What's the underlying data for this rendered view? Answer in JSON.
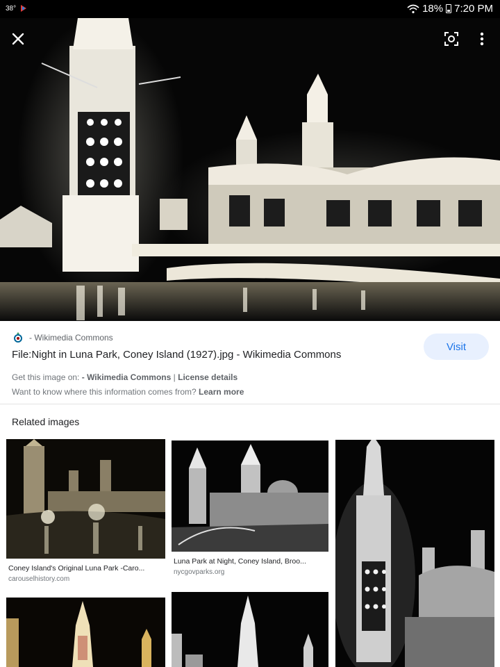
{
  "status": {
    "left_text": "38°",
    "battery": "18%",
    "time": "7:20 PM"
  },
  "image": {
    "source_prefix": "- Wikimedia Commons",
    "title": "File:Night in Luna Park, Coney Island (1927).jpg - Wikimedia Commons",
    "visit_label": "Visit",
    "get_image_label": "Get this image on:",
    "get_image_source": "- Wikimedia Commons",
    "separator": "|",
    "license_label": "License details",
    "info_question": "Want to know where this information comes from?",
    "learn_more": "Learn more"
  },
  "related": {
    "heading": "Related images",
    "items": [
      {
        "caption": "Coney Island's Original Luna Park -Caro...",
        "domain": "carouselhistory.com"
      },
      {
        "caption": "Luna Park at Night, Coney Island, Broo...",
        "domain": "nycgovparks.org"
      }
    ]
  },
  "icons": {
    "close": "close-icon",
    "lens": "lens-icon",
    "more": "more-vert-icon",
    "wifi": "wifi-icon",
    "battery": "battery-icon",
    "wikimedia": "wikimedia-icon"
  }
}
